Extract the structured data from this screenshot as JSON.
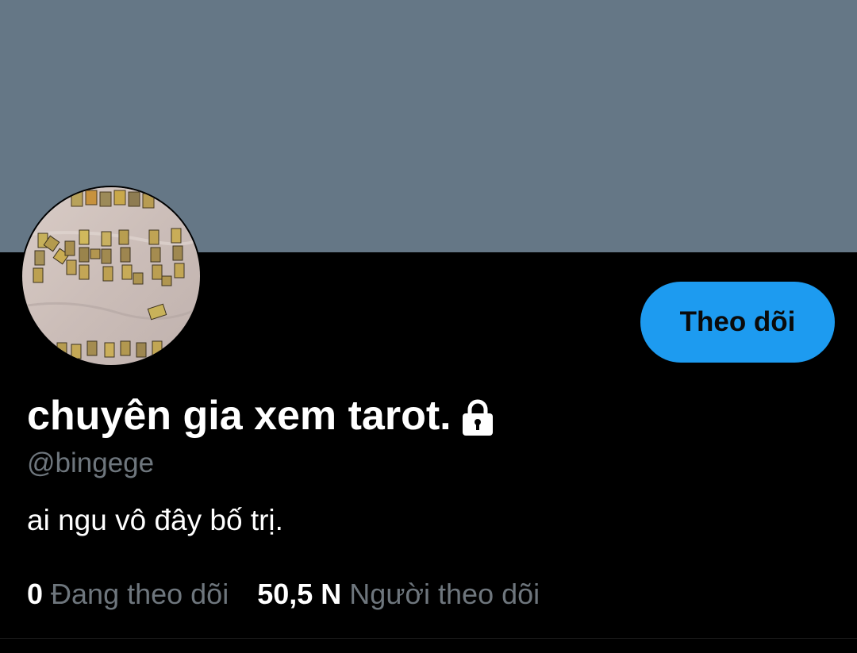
{
  "colors": {
    "banner": "#657786",
    "background": "#000000",
    "accent": "#1d9bf0",
    "secondary_text": "#6e767d",
    "primary_text": "#ffffff"
  },
  "profile": {
    "display_name": "chuyên gia xem tarot.",
    "protected_icon": "lock-icon",
    "handle": "@bingege",
    "bio": "ai ngu vô đây bố trị.",
    "avatar_text": "NHU"
  },
  "actions": {
    "follow_label": "Theo dõi"
  },
  "stats": [
    {
      "count": "0",
      "label": "Đang theo dõi"
    },
    {
      "count": "50,5 N",
      "label": "Người theo dõi"
    }
  ]
}
